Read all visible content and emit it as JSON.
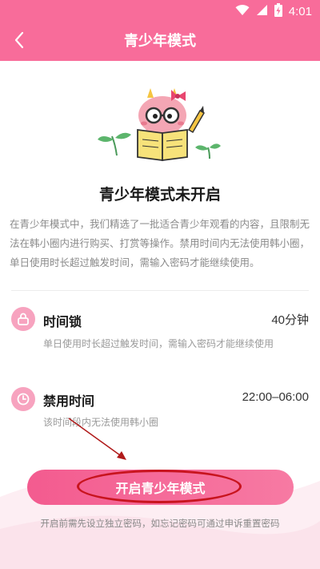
{
  "status_bar": {
    "time": "4:01"
  },
  "header": {
    "title": "青少年模式"
  },
  "main": {
    "title": "青少年模式未开启",
    "description": "在青少年模式中，我们精选了一批适合青少年观看的内容，且限制无法在韩小圈内进行购买、打赏等操作。禁用时间内无法使用韩小圈，单日使用时长超过触发时间，需输入密码才能继续使用。"
  },
  "features": [
    {
      "title": "时间锁",
      "value": "40分钟",
      "desc": "单日使用时长超过触发时间，需输入密码才能继续使用",
      "icon": "lock-icon"
    },
    {
      "title": "禁用时间",
      "value": "22:00–06:00",
      "desc": "该时间段内无法使用韩小圈",
      "icon": "clock-icon"
    }
  ],
  "actions": {
    "start_label": "开启青少年模式"
  },
  "footer": {
    "note": "开启前需先设立独立密码，如忘记密码可通过申诉重置密码"
  },
  "colors": {
    "brand_pink": "#f86c9a",
    "icon_pink": "#f7a3bf",
    "annotation_red": "#c8141e"
  }
}
